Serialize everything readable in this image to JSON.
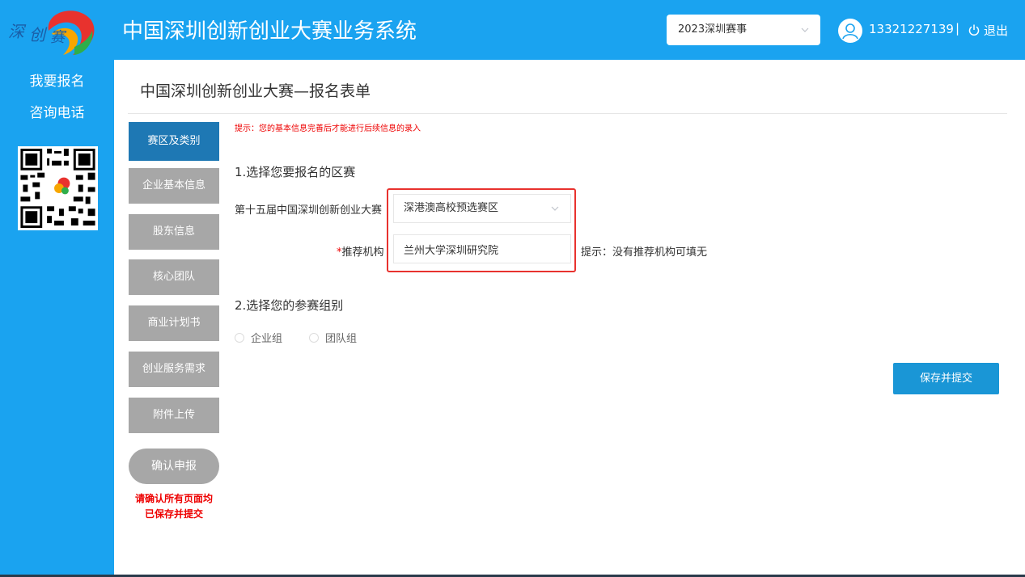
{
  "header": {
    "app_title": "中国深圳创新创业大赛业务系统",
    "season_selected": "2023深圳赛事",
    "user_phone": "13321227139",
    "separator": "|",
    "logout_label": "退出"
  },
  "sidebar": {
    "links": [
      "我要报名",
      "咨询电话"
    ]
  },
  "main": {
    "page_heading": "中国深圳创新创业大赛—报名表单",
    "tip": "提示：您的基本信息完善后才能进行后续信息的录入",
    "steps": [
      "赛区及类别",
      "企业基本信息",
      "股东信息",
      "核心团队",
      "商业计划书",
      "创业服务需求",
      "附件上传"
    ],
    "active_step": 0,
    "confirm_label": "确认申报",
    "confirm_note_line1": "请确认所有页面均",
    "confirm_note_line2": "已保存并提交",
    "section1_title": "1.选择您要报名的区赛",
    "competition_label": "第十五届中国深圳创新创业大赛",
    "region_selected": "深港澳高校预选赛区",
    "org_label_required": "*",
    "org_label": "推荐机构",
    "org_value": "兰州大学深圳研究院",
    "org_hint": "提示：没有推荐机构可填无",
    "section2_title": "2.选择您的参赛组别",
    "group_options": [
      "企业组",
      "团队组"
    ],
    "submit_label": "保存并提交"
  },
  "colors": {
    "primary_blue": "#1aa3f0",
    "active_step": "#1e78b4",
    "inactive_step": "#a7a7a7",
    "highlight_red": "#e8322e",
    "warning_red": "#e00000"
  }
}
